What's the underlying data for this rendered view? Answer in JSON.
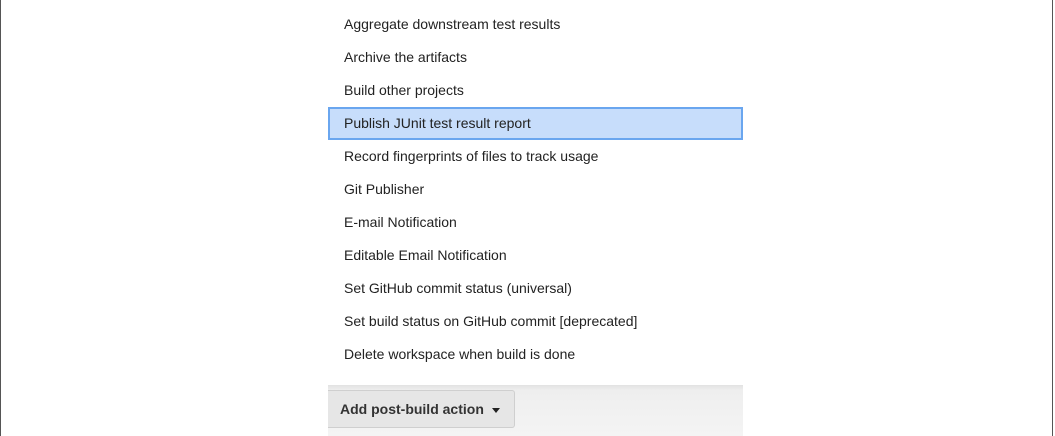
{
  "dropdown": {
    "items": [
      {
        "label": "Aggregate downstream test results"
      },
      {
        "label": "Archive the artifacts"
      },
      {
        "label": "Build other projects"
      },
      {
        "label": "Publish JUnit test result report"
      },
      {
        "label": "Record fingerprints of files to track usage"
      },
      {
        "label": "Git Publisher"
      },
      {
        "label": "E-mail Notification"
      },
      {
        "label": "Editable Email Notification"
      },
      {
        "label": "Set GitHub commit status (universal)"
      },
      {
        "label": "Set build status on GitHub commit [deprecated]"
      },
      {
        "label": "Delete workspace when build is done"
      }
    ],
    "highlighted_label": "Publish JUnit test result report"
  },
  "action_bar": {
    "button_label": "Add post-build action",
    "button_icon": "chevron-down-icon"
  },
  "colors": {
    "highlight_fill": "#c7ddfb",
    "highlight_border": "#6aa6ef",
    "button_fill": "#e6e6e6",
    "text": "#222222"
  }
}
